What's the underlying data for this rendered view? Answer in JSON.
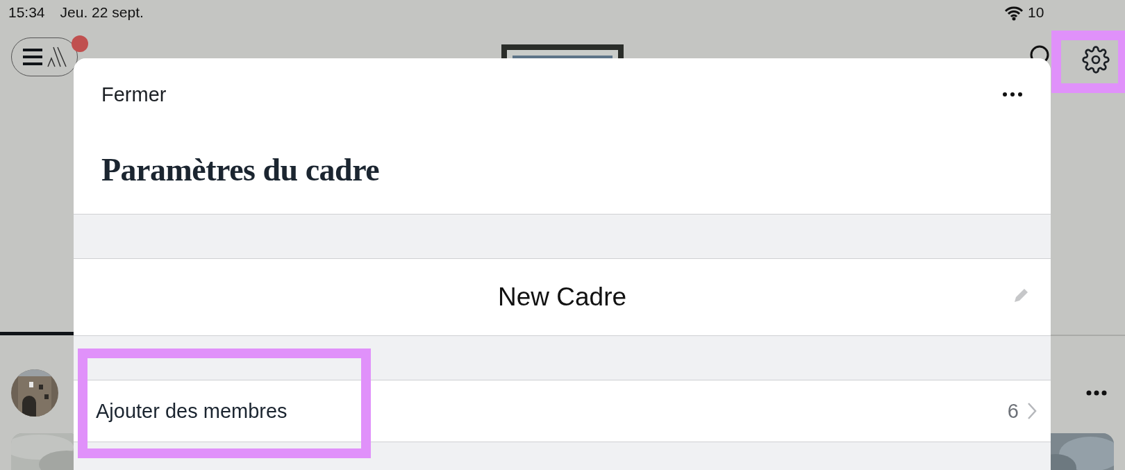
{
  "status_bar": {
    "time": "15:34",
    "date": "Jeu. 22 sept.",
    "battery": "10"
  },
  "sheet": {
    "close": "Fermer",
    "title": "Paramètres du cadre",
    "rows": [
      {
        "kind": "name",
        "text": "New Cadre"
      },
      {
        "kind": "link",
        "label": "Ajouter des membres",
        "count": "6"
      }
    ]
  }
}
